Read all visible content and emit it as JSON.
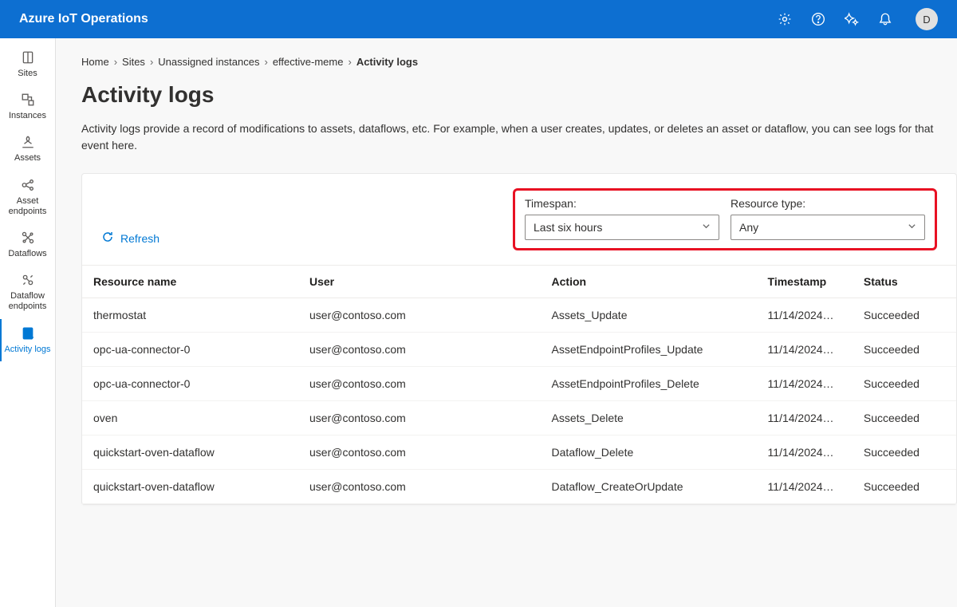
{
  "header": {
    "title": "Azure IoT Operations",
    "avatar": "D"
  },
  "sidebar": {
    "items": [
      {
        "label": "Sites"
      },
      {
        "label": "Instances"
      },
      {
        "label": "Assets"
      },
      {
        "label": "Asset endpoints"
      },
      {
        "label": "Dataflows"
      },
      {
        "label": "Dataflow endpoints"
      },
      {
        "label": "Activity logs"
      }
    ]
  },
  "breadcrumb": {
    "items": [
      "Home",
      "Sites",
      "Unassigned instances",
      "effective-meme"
    ],
    "current": "Activity logs"
  },
  "page": {
    "title": "Activity logs",
    "description": "Activity logs provide a record of modifications to assets, dataflows, etc. For example, when a user creates, updates, or deletes an asset or dataflow, you can see logs for that event here."
  },
  "toolbar": {
    "refresh": "Refresh",
    "filters": {
      "timespan": {
        "label": "Timespan:",
        "value": "Last six hours"
      },
      "resource_type": {
        "label": "Resource type:",
        "value": "Any"
      }
    }
  },
  "table": {
    "columns": [
      "Resource name",
      "User",
      "Action",
      "Timestamp",
      "Status"
    ],
    "rows": [
      {
        "resource": "thermostat",
        "user": "user@contoso.com",
        "action": "Assets_Update",
        "timestamp": "11/14/2024…",
        "status": "Succeeded"
      },
      {
        "resource": "opc-ua-connector-0",
        "user": "user@contoso.com",
        "action": "AssetEndpointProfiles_Update",
        "timestamp": "11/14/2024…",
        "status": "Succeeded"
      },
      {
        "resource": "opc-ua-connector-0",
        "user": "user@contoso.com",
        "action": "AssetEndpointProfiles_Delete",
        "timestamp": "11/14/2024…",
        "status": "Succeeded"
      },
      {
        "resource": "oven",
        "user": "user@contoso.com",
        "action": "Assets_Delete",
        "timestamp": "11/14/2024…",
        "status": "Succeeded"
      },
      {
        "resource": "quickstart-oven-dataflow",
        "user": "user@contoso.com",
        "action": "Dataflow_Delete",
        "timestamp": "11/14/2024…",
        "status": "Succeeded"
      },
      {
        "resource": "quickstart-oven-dataflow",
        "user": "user@contoso.com",
        "action": "Dataflow_CreateOrUpdate",
        "timestamp": "11/14/2024…",
        "status": "Succeeded"
      }
    ]
  }
}
